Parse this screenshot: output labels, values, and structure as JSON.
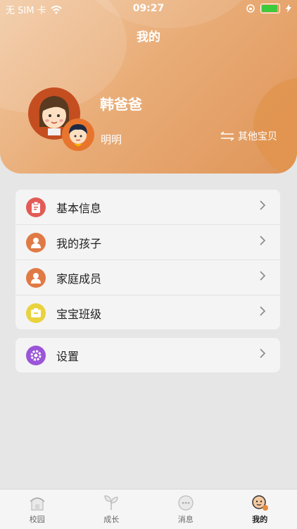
{
  "status": {
    "carrier": "无 SIM 卡",
    "time": "09:27"
  },
  "header": {
    "title": "我的"
  },
  "profile": {
    "parent_name": "韩爸爸",
    "child_name": "明明",
    "switch_label": "其他宝贝"
  },
  "menu": {
    "items": [
      {
        "label": "基本信息",
        "icon": "clipboard-icon",
        "color": "#e25b57"
      },
      {
        "label": "我的孩子",
        "icon": "child-icon",
        "color": "#e07a45"
      },
      {
        "label": "家庭成员",
        "icon": "family-icon",
        "color": "#e07a45"
      },
      {
        "label": "宝宝班级",
        "icon": "class-icon",
        "color": "#ead23c"
      }
    ],
    "settings": {
      "label": "设置",
      "icon": "gear-icon",
      "color": "#9b55d8"
    }
  },
  "tabs": [
    {
      "label": "校园",
      "icon": "campus-icon",
      "active": false
    },
    {
      "label": "成长",
      "icon": "growth-icon",
      "active": false
    },
    {
      "label": "消息",
      "icon": "message-icon",
      "active": false
    },
    {
      "label": "我的",
      "icon": "mine-icon",
      "active": true
    }
  ]
}
